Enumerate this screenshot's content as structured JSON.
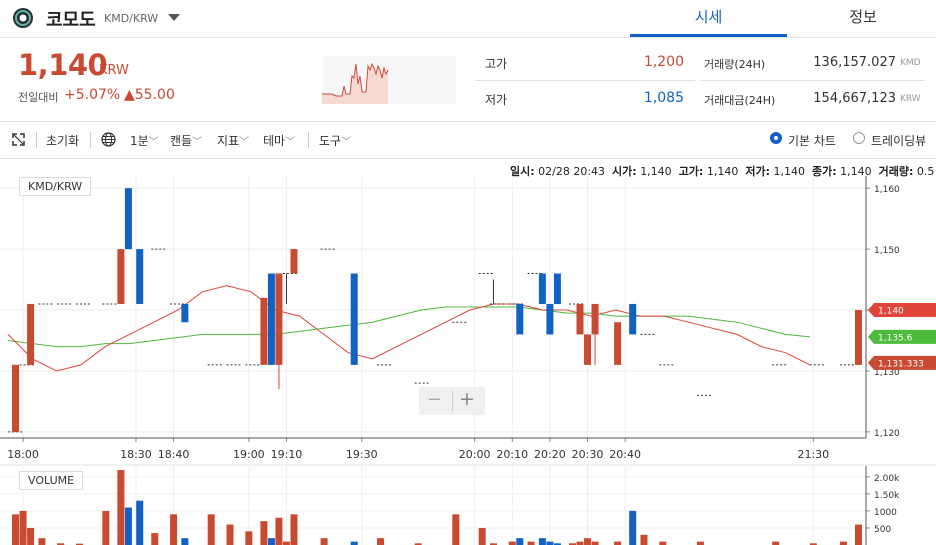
{
  "header": {
    "coin_name": "코모도",
    "pair": "KMD/KRW",
    "tabs": [
      "시세",
      "정보"
    ]
  },
  "summary": {
    "price": "1,140",
    "unit": "KRW",
    "change_label": "전일대비",
    "change_pct": "+5.07%",
    "change_abs": "▲55.00",
    "high_label": "고가",
    "high": "1,200",
    "low_label": "저가",
    "low": "1,085",
    "volume_label": "거래량(24H)",
    "volume": "136,157.027",
    "volume_unit": "KMD",
    "amount_label": "거래대금(24H)",
    "amount": "154,667,123",
    "amount_unit": "KRW"
  },
  "toolbar": {
    "reset": "초기화",
    "interval": "1분",
    "candle": "캔들",
    "indicator": "지표",
    "theme": "테마",
    "tools": "도구",
    "basic_chart": "기본 차트",
    "tradingview": "트레이딩뷰"
  },
  "readout": {
    "time_label": "일시:",
    "time": "02/28 20:43",
    "open_label": "시가:",
    "open": "1,140",
    "high_label": "고가:",
    "high": "1,140",
    "low_label": "저가:",
    "low": "1,140",
    "close_label": "종가:",
    "close": "1,140",
    "vol_label": "거래량:",
    "vol": "0.5"
  },
  "colors": {
    "up": "#c84a31",
    "down": "#1261c4",
    "ma_red": "#e0453a",
    "ma_green": "#4cbb3c"
  },
  "chart_data": {
    "type": "candlestick",
    "pair_label": "KMD/KRW",
    "volume_label": "VOLUME",
    "x_ticks": [
      "18:00",
      "18:30",
      "18:40",
      "19:00",
      "19:10",
      "19:30",
      "20:00",
      "20:10",
      "20:20",
      "20:30",
      "20:40",
      "21:30"
    ],
    "y_ticks": [
      "1,160",
      "1,150",
      "1,140",
      "1,130",
      "1,120"
    ],
    "ylim": [
      1119,
      1162
    ],
    "volume_ticks": [
      "2.00k",
      "1.50k",
      "1000",
      "500"
    ],
    "volume_ylim": [
      0,
      2200
    ],
    "price_flags": [
      {
        "label": "1,140",
        "value": 1140,
        "color": "#e0453a"
      },
      {
        "label": "1,135.6",
        "value": 1135.6,
        "color": "#4cbb3c"
      },
      {
        "label": "1,131.333",
        "value": 1131.333,
        "color": "#c84a31"
      }
    ],
    "time_span": [
      "17:56",
      "21:44"
    ],
    "candles": [
      {
        "t": "17:57",
        "o": 1120,
        "h": 1120,
        "l": 1120,
        "c": 1120,
        "v": 0
      },
      {
        "t": "17:58",
        "o": 1120,
        "h": 1131,
        "l": 1120,
        "c": 1131,
        "v": 900
      },
      {
        "t": "18:00",
        "o": 1131,
        "h": 1131,
        "l": 1131,
        "c": 1131,
        "v": 1000
      },
      {
        "t": "18:02",
        "o": 1131,
        "h": 1141,
        "l": 1131,
        "c": 1141,
        "v": 500
      },
      {
        "t": "18:05",
        "o": 1141,
        "h": 1141,
        "l": 1141,
        "c": 1141,
        "v": 200
      },
      {
        "t": "18:10",
        "o": 1141,
        "h": 1141,
        "l": 1141,
        "c": 1141,
        "v": 50
      },
      {
        "t": "18:15",
        "o": 1141,
        "h": 1141,
        "l": 1141,
        "c": 1141,
        "v": 40
      },
      {
        "t": "18:22",
        "o": 1141,
        "h": 1141,
        "l": 1141,
        "c": 1141,
        "v": 1000
      },
      {
        "t": "18:26",
        "o": 1141,
        "h": 1150,
        "l": 1141,
        "c": 1150,
        "v": 2200
      },
      {
        "t": "18:28",
        "o": 1160,
        "h": 1160,
        "l": 1150,
        "c": 1150,
        "v": 1100
      },
      {
        "t": "18:31",
        "o": 1150,
        "h": 1150,
        "l": 1141,
        "c": 1141,
        "v": 1300
      },
      {
        "t": "18:35",
        "o": 1150,
        "h": 1150,
        "l": 1150,
        "c": 1150,
        "v": 350
      },
      {
        "t": "18:40",
        "o": 1141,
        "h": 1141,
        "l": 1141,
        "c": 1141,
        "v": 900
      },
      {
        "t": "18:43",
        "o": 1141,
        "h": 1141,
        "l": 1138,
        "c": 1138,
        "v": 200
      },
      {
        "t": "18:50",
        "o": 1131,
        "h": 1131,
        "l": 1131,
        "c": 1131,
        "v": 900
      },
      {
        "t": "18:55",
        "o": 1131,
        "h": 1131,
        "l": 1131,
        "c": 1131,
        "v": 600
      },
      {
        "t": "19:00",
        "o": 1131,
        "h": 1131,
        "l": 1131,
        "c": 1131,
        "v": 400
      },
      {
        "t": "19:04",
        "o": 1131,
        "h": 1142,
        "l": 1131,
        "c": 1142,
        "v": 700
      },
      {
        "t": "19:06",
        "o": 1146,
        "h": 1146,
        "l": 1131,
        "c": 1131,
        "v": 200
      },
      {
        "t": "19:08",
        "o": 1131,
        "h": 1146,
        "l": 1127,
        "c": 1146,
        "v": 800
      },
      {
        "t": "19:10",
        "o": 1146,
        "h": 1146,
        "l": 1141,
        "c": 1146,
        "v": 100
      },
      {
        "t": "19:12",
        "o": 1146,
        "h": 1150,
        "l": 1146,
        "c": 1150,
        "v": 900
      },
      {
        "t": "19:20",
        "o": 1150,
        "h": 1150,
        "l": 1150,
        "c": 1150,
        "v": 200
      },
      {
        "t": "19:28",
        "o": 1146,
        "h": 1146,
        "l": 1131,
        "c": 1131,
        "v": 100
      },
      {
        "t": "19:35",
        "o": 1131,
        "h": 1131,
        "l": 1131,
        "c": 1131,
        "v": 200
      },
      {
        "t": "19:45",
        "o": 1128,
        "h": 1128,
        "l": 1128,
        "c": 1128,
        "v": 50
      },
      {
        "t": "19:55",
        "o": 1138,
        "h": 1138,
        "l": 1138,
        "c": 1138,
        "v": 900
      },
      {
        "t": "20:02",
        "o": 1146,
        "h": 1146,
        "l": 1146,
        "c": 1146,
        "v": 500
      },
      {
        "t": "20:05",
        "o": 1141,
        "h": 1145,
        "l": 1141,
        "c": 1141,
        "v": 50
      },
      {
        "t": "20:10",
        "o": 1141,
        "h": 1141,
        "l": 1141,
        "c": 1141,
        "v": 100
      },
      {
        "t": "20:12",
        "o": 1141,
        "h": 1141,
        "l": 1136,
        "c": 1136,
        "v": 200
      },
      {
        "t": "20:15",
        "o": 1146,
        "h": 1146,
        "l": 1146,
        "c": 1146,
        "v": 100
      },
      {
        "t": "20:18",
        "o": 1146,
        "h": 1146,
        "l": 1141,
        "c": 1141,
        "v": 200
      },
      {
        "t": "20:20",
        "o": 1141,
        "h": 1141,
        "l": 1136,
        "c": 1136,
        "v": 100
      },
      {
        "t": "20:22",
        "o": 1146,
        "h": 1146,
        "l": 1141,
        "c": 1141,
        "v": 50
      },
      {
        "t": "20:26",
        "o": 1141,
        "h": 1141,
        "l": 1141,
        "c": 1141,
        "v": 50
      },
      {
        "t": "20:28",
        "o": 1136,
        "h": 1141,
        "l": 1136,
        "c": 1141,
        "v": 100
      },
      {
        "t": "20:30",
        "o": 1131,
        "h": 1136,
        "l": 1131,
        "c": 1136,
        "v": 200
      },
      {
        "t": "20:32",
        "o": 1136,
        "h": 1141,
        "l": 1131,
        "c": 1141,
        "v": 100
      },
      {
        "t": "20:38",
        "o": 1131,
        "h": 1138,
        "l": 1131,
        "c": 1138,
        "v": 100
      },
      {
        "t": "20:42",
        "o": 1141,
        "h": 1141,
        "l": 1136,
        "c": 1136,
        "v": 1000
      },
      {
        "t": "20:45",
        "o": 1136,
        "h": 1136,
        "l": 1136,
        "c": 1136,
        "v": 300
      },
      {
        "t": "20:50",
        "o": 1131,
        "h": 1131,
        "l": 1131,
        "c": 1131,
        "v": 100
      },
      {
        "t": "21:00",
        "o": 1126,
        "h": 1126,
        "l": 1126,
        "c": 1126,
        "v": 100
      },
      {
        "t": "21:20",
        "o": 1131,
        "h": 1131,
        "l": 1131,
        "c": 1131,
        "v": 100
      },
      {
        "t": "21:30",
        "o": 1131,
        "h": 1131,
        "l": 1131,
        "c": 1131,
        "v": 50
      },
      {
        "t": "21:38",
        "o": 1131,
        "h": 1131,
        "l": 1131,
        "c": 1131,
        "v": 100
      },
      {
        "t": "21:42",
        "o": 1131,
        "h": 1140,
        "l": 1131,
        "c": 1140,
        "v": 600
      }
    ],
    "ma_red": [
      1136,
      1132,
      1130,
      1131,
      1134,
      1136,
      1138,
      1140,
      1143,
      1144,
      1143,
      1140,
      1139,
      1136,
      1133,
      1132,
      1134,
      1136,
      1138,
      1140,
      1141,
      1141,
      1140,
      1140,
      1139,
      1140,
      1139,
      1139,
      1138,
      1137,
      1136,
      1134,
      1133,
      1131
    ],
    "ma_green": [
      1135,
      1134.5,
      1134,
      1134,
      1134.5,
      1134.5,
      1135,
      1135.5,
      1136,
      1136,
      1136,
      1136,
      1136.5,
      1137,
      1137.5,
      1138,
      1139,
      1140,
      1140.5,
      1140.5,
      1140.5,
      1140.5,
      1140,
      1139.5,
      1139.5,
      1139,
      1139,
      1139,
      1139,
      1138.5,
      1138,
      1137,
      1136,
      1135.6
    ]
  }
}
